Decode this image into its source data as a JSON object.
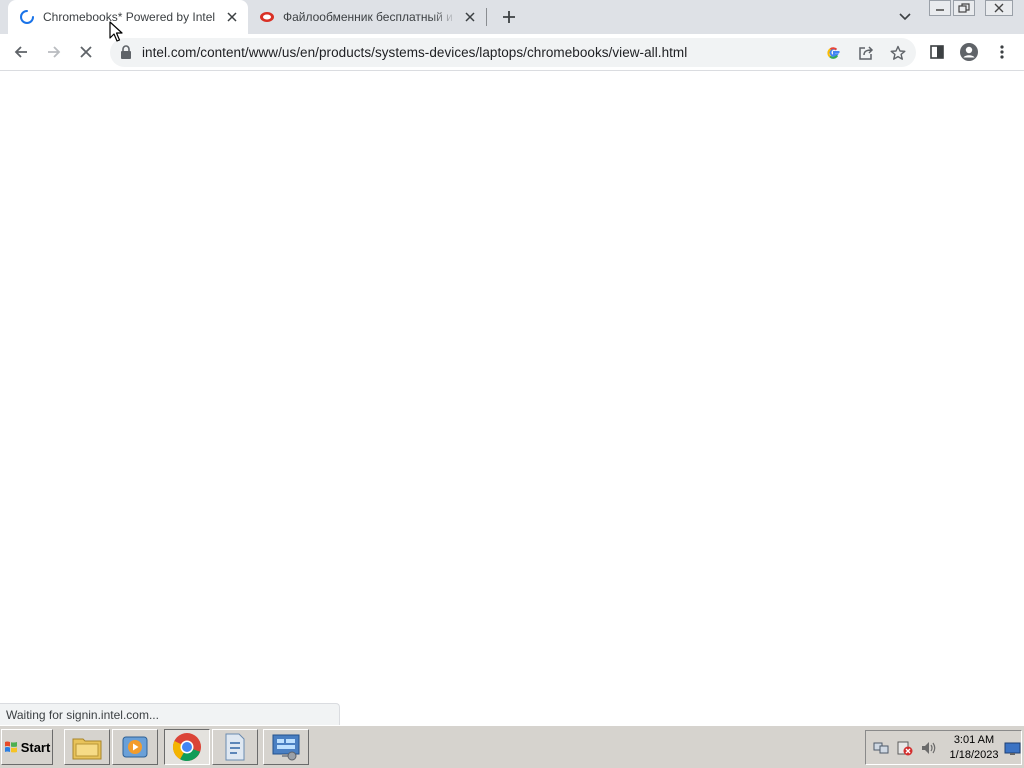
{
  "browser": {
    "tabs": [
      {
        "title": "Chromebooks* Powered by Intel",
        "state": "loading",
        "active": true
      },
      {
        "title": "Файлообменник бесплатный и",
        "state": "loaded",
        "active": false
      }
    ],
    "new_tab_symbol": "+",
    "address_bar": {
      "url": "intel.com/content/www/us/en/products/systems-devices/laptops/chromebooks/view-all.html",
      "secure": true
    },
    "toolbar_icons": [
      "back-icon",
      "forward-icon",
      "stop-loading-icon",
      "lock-icon",
      "google-lens-icon",
      "share-icon",
      "bookmark-star-icon",
      "side-panel-icon",
      "profile-icon",
      "menu-icon"
    ],
    "status_text": "Waiting for signin.intel.com..."
  },
  "taskbar": {
    "start_label": "Start",
    "apps": [
      "file-explorer-icon",
      "media-player-icon",
      "chrome-icon",
      "document-icon",
      "server-manager-icon"
    ],
    "tray_icons": [
      "network-icon",
      "security-alert-icon",
      "volume-icon",
      "show-desktop-icon"
    ],
    "clock": {
      "time": "3:01 AM",
      "date": "1/18/2023"
    }
  },
  "colors": {
    "tab_strip": "#dee1e6",
    "omnibox": "#f1f3f4",
    "spinner": "#1a73e8",
    "taskbar": "#d6d3ce"
  }
}
